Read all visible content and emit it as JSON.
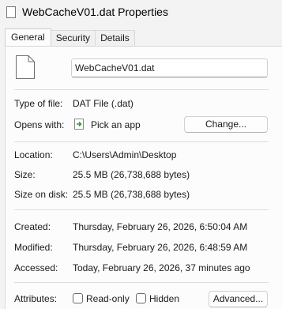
{
  "window": {
    "title": "WebCacheV01.dat Properties"
  },
  "tabs": [
    {
      "label": "General",
      "active": true
    },
    {
      "label": "Security",
      "active": false
    },
    {
      "label": "Details",
      "active": false
    }
  ],
  "general": {
    "file_name": "WebCacheV01.dat",
    "type_label": "Type of file:",
    "type_value": "DAT File (.dat)",
    "opens_label": "Opens with:",
    "opens_value": "Pick an app",
    "change_button": "Change...",
    "location_label": "Location:",
    "location_value": "C:\\Users\\Admin\\Desktop",
    "size_label": "Size:",
    "size_value": "25.5 MB (26,738,688 bytes)",
    "size_on_disk_label": "Size on disk:",
    "size_on_disk_value": "25.5 MB (26,738,688 bytes)",
    "created_label": "Created:",
    "created_value": "Thursday, February 26, 2026, 6:50:04 AM",
    "modified_label": "Modified:",
    "modified_value": "Thursday, February 26, 2026, 6:48:59 AM",
    "accessed_label": "Accessed:",
    "accessed_value": "Today, February 26, 2026, 37 minutes ago",
    "attributes_label": "Attributes:",
    "readonly_label": "Read-only",
    "readonly_checked": false,
    "hidden_label": "Hidden",
    "hidden_checked": false,
    "advanced_button": "Advanced..."
  },
  "icons": {
    "title": "document-icon",
    "file": "document-icon",
    "app": "pick-app-icon"
  }
}
